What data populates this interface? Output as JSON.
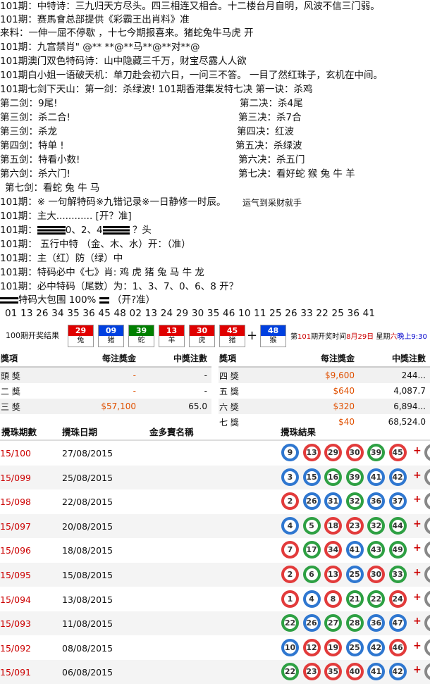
{
  "lines": [
    "101期：中特诗：三九归天方尽头。四三相连又相合。十二楼台月自明，风波不信三门弱。",
    "101期：赛馬會总部提供《彩霸王出肖料》准",
    "来料：一伸一屈不停歇 ，十七今期报喜来。猪蛇兔牛马虎  开",
    "101期：九宫禁肖\" @** **@**马**@**对**@",
    "101期澳门双色特码诗：山中隐藏三千万，财宝尽露人人欲",
    "101期白小姐一语破天机：单刀赴会初六日，一问三不答。  一目了然红珠子，玄机在中间。",
    "101期七剑下天山：第一剑：杀绿波!         101期香港集发特七决 第一诀：杀鸡"
  ],
  "swords": [
    "第二剑：9尾!",
    "第三剑：杀二合!",
    "第三剑：杀龙",
    "第四剑：特单 !",
    "第五剑：特看小数!",
    "第六剑：杀六门!"
  ],
  "jue": [
    "第二决：杀4尾",
    "第三决：杀7合",
    "第四决：红波",
    "第五决：杀绿波",
    "第六决：杀五门",
    "第七决：看好蛇 猴 兔 牛 羊"
  ],
  "line_s7": "第七剑：看蛇 兔 牛 马",
  "line_b1": "101期：※ 一句解特码※九错记录※一日静修一时辰。",
  "line_b1b": "运气到采财就手",
  "line_b2": "101期：主大............  [开？准]",
  "line_b3a": "101期：",
  "line_b3b": "0、2、4",
  "line_b3c": " ？头",
  "line_b4": "101期：   五行中特   （金、木、水）开：（准）",
  "line_b5": "101期：主（红）防（绿）中",
  "line_b6": "101期：特码必中《七》肖: 鸡 虎 猪 兔 马 牛 龙",
  "line_b7": "101期：必中特码（尾数）为：1、3、7、0、6、8      开？",
  "line_b8a": "特码大包围 100%",
  "line_b8b": "（开?准）",
  "big_numbers": "01 13 26 34 35 36 45 48 02 13 24 29 30 35 46 10 11 25 26 33 22 25 36 41",
  "draw": {
    "label": "100期开奖结果",
    "balls": [
      {
        "n": "29",
        "z": "兔",
        "color": "#e00000"
      },
      {
        "n": "09",
        "z": "猪",
        "color": "#0040e0"
      },
      {
        "n": "39",
        "z": "蛇",
        "color": "#008000"
      },
      {
        "n": "13",
        "z": "羊",
        "color": "#e00000"
      },
      {
        "n": "30",
        "z": "虎",
        "color": "#e00000"
      },
      {
        "n": "45",
        "z": "猪",
        "color": "#e00000"
      }
    ],
    "plus": "+",
    "special": {
      "n": "48",
      "z": "猴",
      "color": "#0040e0"
    },
    "info_pre": "第",
    "info_period": "101",
    "info_mid": "期开奖时间",
    "info_date": "8月29日",
    "info_week": "星期",
    "info_day": "六",
    "info_time": "晚上9:30"
  },
  "prize_left": {
    "headers": [
      "獎項",
      "每注獎金",
      "中獎注數"
    ],
    "rows": [
      [
        "頭 獎",
        "-",
        "-"
      ],
      [
        "二 獎",
        "-",
        "-"
      ],
      [
        "三 獎",
        "$57,100",
        "65.0"
      ]
    ]
  },
  "prize_right": {
    "headers": [
      "獎項",
      "每注獎金",
      "中獎注數"
    ],
    "rows": [
      [
        "四 獎",
        "$9,600",
        "244..."
      ],
      [
        "五 獎",
        "$640",
        "4,087.7"
      ],
      [
        "六 獎",
        "$320",
        "6,894..."
      ],
      [
        "七 獎",
        "$40",
        "68,524.0"
      ]
    ]
  },
  "history": {
    "headers": [
      "攪珠期數",
      "攪珠日期",
      "金多寶名稱",
      "攪珠結果"
    ],
    "rows": [
      {
        "period": "15/100",
        "date": "27/08/2015",
        "balls": [
          [
            "9",
            "blue"
          ],
          [
            "13",
            "red"
          ],
          [
            "29",
            "red"
          ],
          [
            "30",
            "red"
          ],
          [
            "39",
            "green"
          ],
          [
            "45",
            "red"
          ]
        ]
      },
      {
        "period": "15/099",
        "date": "25/08/2015",
        "balls": [
          [
            "3",
            "blue"
          ],
          [
            "15",
            "blue"
          ],
          [
            "16",
            "green"
          ],
          [
            "39",
            "green"
          ],
          [
            "41",
            "blue"
          ],
          [
            "42",
            "blue"
          ]
        ]
      },
      {
        "period": "15/098",
        "date": "22/08/2015",
        "balls": [
          [
            "2",
            "red"
          ],
          [
            "26",
            "blue"
          ],
          [
            "31",
            "blue"
          ],
          [
            "32",
            "green"
          ],
          [
            "36",
            "blue"
          ],
          [
            "37",
            "blue"
          ]
        ]
      },
      {
        "period": "15/097",
        "date": "20/08/2015",
        "balls": [
          [
            "4",
            "blue"
          ],
          [
            "5",
            "green"
          ],
          [
            "18",
            "red"
          ],
          [
            "23",
            "red"
          ],
          [
            "32",
            "green"
          ],
          [
            "44",
            "green"
          ]
        ]
      },
      {
        "period": "15/096",
        "date": "18/08/2015",
        "balls": [
          [
            "7",
            "red"
          ],
          [
            "17",
            "green"
          ],
          [
            "34",
            "red"
          ],
          [
            "41",
            "blue"
          ],
          [
            "43",
            "green"
          ],
          [
            "49",
            "green"
          ]
        ]
      },
      {
        "period": "15/095",
        "date": "15/08/2015",
        "balls": [
          [
            "2",
            "red"
          ],
          [
            "6",
            "green"
          ],
          [
            "13",
            "red"
          ],
          [
            "25",
            "blue"
          ],
          [
            "30",
            "red"
          ],
          [
            "33",
            "green"
          ]
        ]
      },
      {
        "period": "15/094",
        "date": "13/08/2015",
        "balls": [
          [
            "1",
            "red"
          ],
          [
            "4",
            "blue"
          ],
          [
            "8",
            "red"
          ],
          [
            "21",
            "green"
          ],
          [
            "22",
            "green"
          ],
          [
            "24",
            "red"
          ]
        ]
      },
      {
        "period": "15/093",
        "date": "11/08/2015",
        "balls": [
          [
            "22",
            "green"
          ],
          [
            "26",
            "blue"
          ],
          [
            "27",
            "green"
          ],
          [
            "28",
            "green"
          ],
          [
            "36",
            "blue"
          ],
          [
            "47",
            "blue"
          ]
        ]
      },
      {
        "period": "15/092",
        "date": "08/08/2015",
        "balls": [
          [
            "10",
            "blue"
          ],
          [
            "12",
            "red"
          ],
          [
            "19",
            "red"
          ],
          [
            "25",
            "blue"
          ],
          [
            "42",
            "blue"
          ],
          [
            "46",
            "red"
          ]
        ]
      },
      {
        "period": "15/091",
        "date": "06/08/2015",
        "balls": [
          [
            "22",
            "green"
          ],
          [
            "23",
            "red"
          ],
          [
            "35",
            "red"
          ],
          [
            "40",
            "red"
          ],
          [
            "41",
            "blue"
          ],
          [
            "42",
            "blue"
          ]
        ]
      }
    ],
    "plus": "+"
  }
}
